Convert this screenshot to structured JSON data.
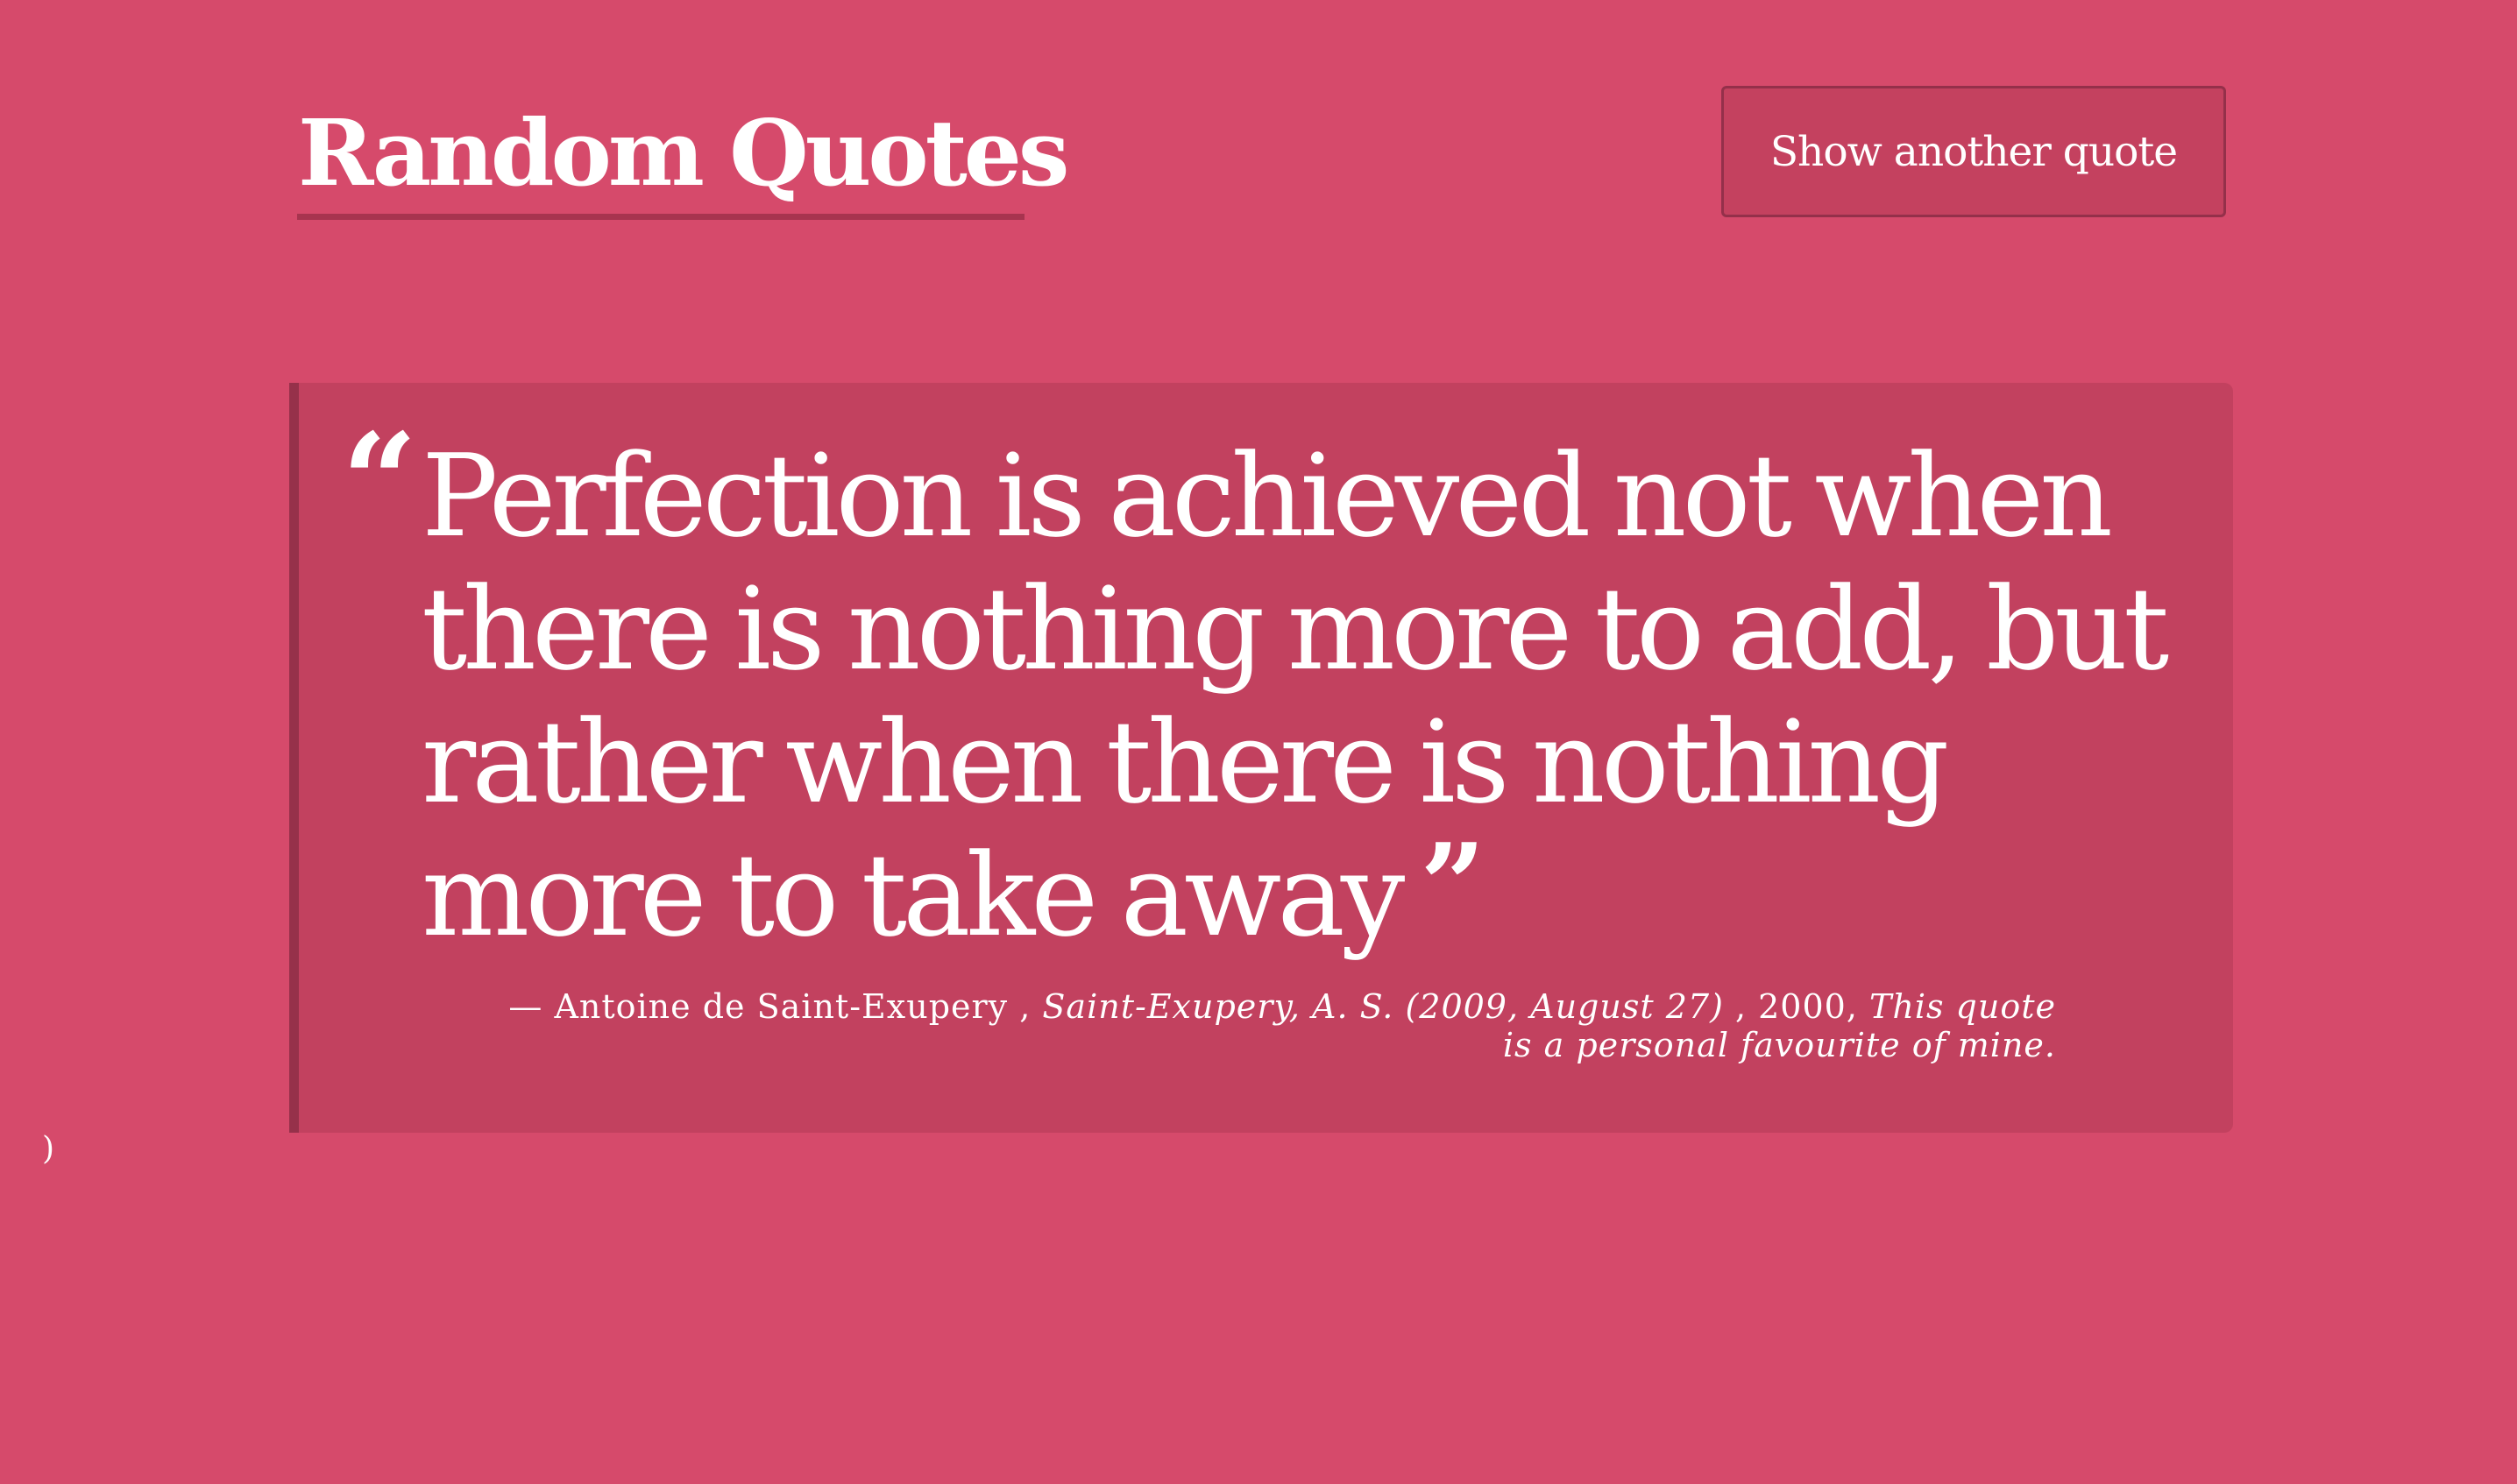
{
  "header": {
    "title": "Random Quotes",
    "another_button_label": "Show another quote"
  },
  "quote": {
    "open_mark": "“",
    "text": "Perfection is achieved not when there is nothing more to add, but rather when there is nothing more to take away",
    "close_mark": "”",
    "attribution": {
      "dash": "— ",
      "author": "Antoine de Saint-Exupery",
      "separator_1": " , ",
      "citation": "Saint-Exupery, A. S. (2009, August 27)",
      "separator_2": " , 2000, ",
      "note": "This quote is a personal favourite of mine."
    }
  },
  "footer": {
    "stray_text": ")"
  },
  "colors": {
    "background": "#D64A6B",
    "card": "#C2415F",
    "accent_border": "#96314A",
    "text": "#FFFFFF"
  }
}
